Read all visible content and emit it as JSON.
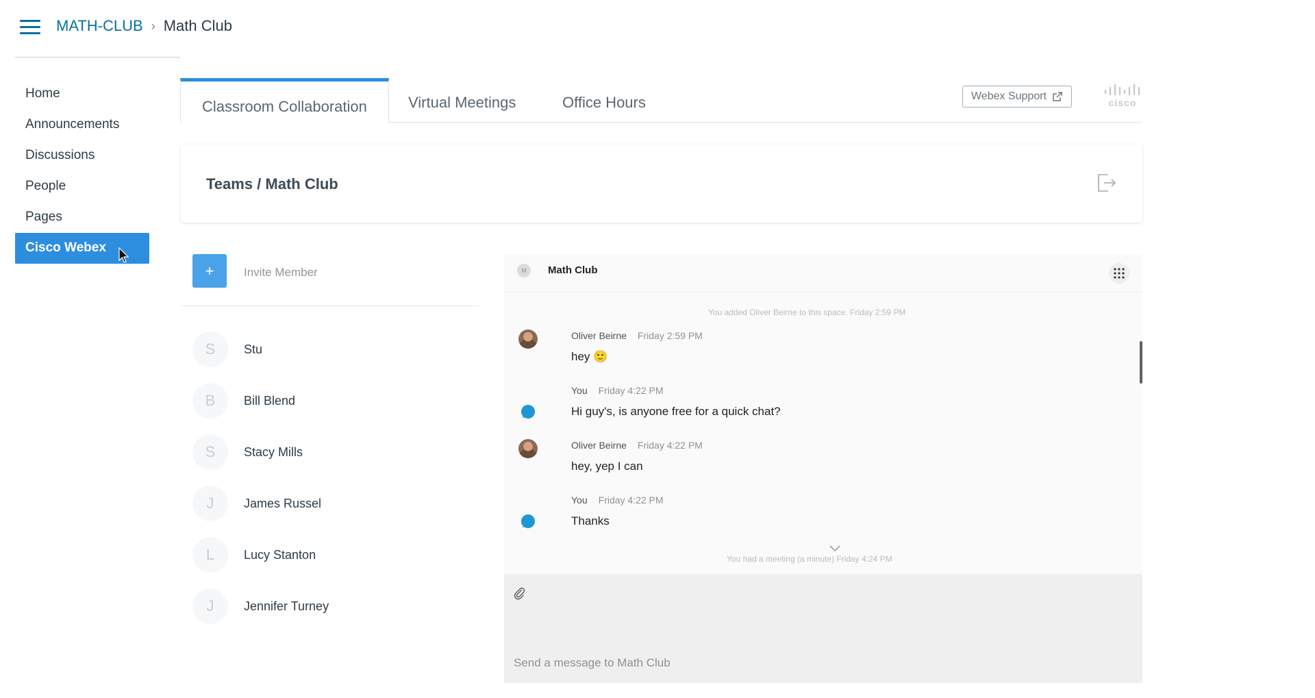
{
  "header": {
    "breadcrumb_course": "MATH-CLUB",
    "breadcrumb_separator": "›",
    "breadcrumb_current": "Math Club"
  },
  "sidebar": {
    "items": [
      {
        "label": "Home"
      },
      {
        "label": "Announcements"
      },
      {
        "label": "Discussions"
      },
      {
        "label": "People"
      },
      {
        "label": "Pages"
      },
      {
        "label": "Cisco Webex",
        "active": true
      }
    ]
  },
  "tabs": [
    {
      "label": "Classroom Collaboration",
      "active": true
    },
    {
      "label": "Virtual Meetings"
    },
    {
      "label": "Office Hours"
    }
  ],
  "support_button": "Webex Support",
  "teams": {
    "title": "Teams / Math Club"
  },
  "members": {
    "invite_label": "Invite Member",
    "invite_symbol": "+",
    "list": [
      {
        "initial": "S",
        "name": "Stu"
      },
      {
        "initial": "B",
        "name": "Bill Blend"
      },
      {
        "initial": "S",
        "name": "Stacy Mills"
      },
      {
        "initial": "J",
        "name": "James Russel"
      },
      {
        "initial": "L",
        "name": "Lucy Stanton"
      },
      {
        "initial": "J",
        "name": "Jennifer Turney"
      }
    ]
  },
  "chat": {
    "space_initial": "M",
    "title": "Math Club",
    "system_top": "You added Oliver Beirne to this space. Friday 2:59 PM",
    "system_bottom": "You had a meeting (a minute) Friday 4:24 PM",
    "messages": [
      {
        "author": "Oliver Beirne",
        "time": "Friday 2:59 PM",
        "text": "hey 🙂",
        "avatar": "photo"
      },
      {
        "author": "You",
        "time": "Friday 4:22 PM",
        "text": "Hi guy's, is anyone free for a quick chat?",
        "avatar": "bubble"
      },
      {
        "author": "Oliver Beirne",
        "time": "Friday 4:22 PM",
        "text": "hey, yep I can",
        "avatar": "photo"
      },
      {
        "author": "You",
        "time": "Friday 4:22 PM",
        "text": "Thanks",
        "avatar": "bubble"
      }
    ],
    "composer_placeholder": "Send a message to Math Club"
  },
  "colors": {
    "link": "#0770a3",
    "accent": "#2d8ee0",
    "invite": "#4aa3e8",
    "bubble": "#1f97d4"
  }
}
